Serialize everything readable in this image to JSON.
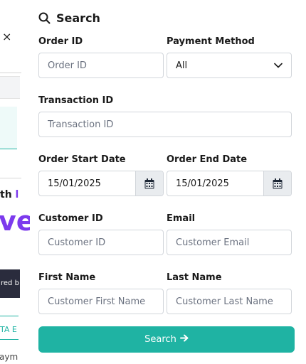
{
  "background": {
    "close_glyph": "×",
    "fragment_th": "th",
    "fragment_th_accent": "l",
    "fragment_big": "ve",
    "fragment_dark": "red b",
    "fragment_teal": "TA E",
    "fragment_gray": "aym"
  },
  "drawer": {
    "title": "Search",
    "title_icon": "search-icon",
    "fields": {
      "order_id": {
        "label": "Order ID",
        "placeholder": "Order ID"
      },
      "payment_method": {
        "label": "Payment Method",
        "value": "All"
      },
      "transaction_id": {
        "label": "Transaction ID",
        "placeholder": "Transaction ID"
      },
      "order_start_date": {
        "label": "Order Start Date",
        "value": "15/01/2025"
      },
      "order_end_date": {
        "label": "Order End Date",
        "value": "15/01/2025"
      },
      "customer_id": {
        "label": "Customer ID",
        "placeholder": "Customer ID"
      },
      "email": {
        "label": "Email",
        "placeholder": "Customer Email"
      },
      "first_name": {
        "label": "First Name",
        "placeholder": "Customer First Name"
      },
      "last_name": {
        "label": "Last Name",
        "placeholder": "Customer Last Name"
      }
    },
    "search_button": {
      "label": "Search",
      "icon": "arrow-right-icon"
    }
  },
  "colors": {
    "accent": "#1fb3a3",
    "brand_purple": "#7c3aed",
    "border": "#d2d6db",
    "calendar_bg": "#e9ecef"
  }
}
